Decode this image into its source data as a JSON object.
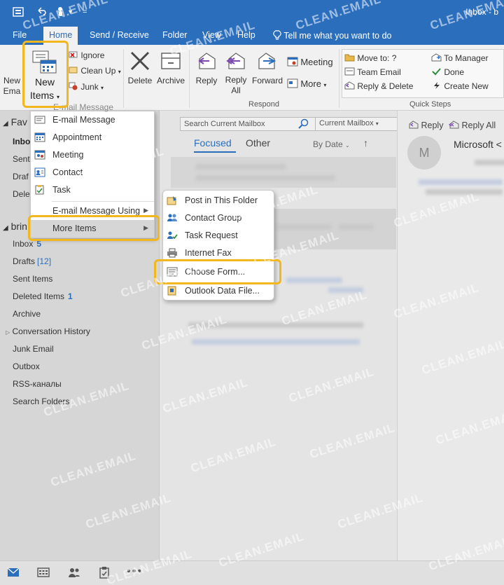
{
  "titlebar": {
    "window_title": "Inbox - b",
    "qa_customize": "="
  },
  "tabs": [
    "File",
    "Home",
    "Send / Receive",
    "Folder",
    "View",
    "Help"
  ],
  "tell_me": "Tell me what you want to do",
  "ribbon": {
    "new_email_line1": "New",
    "new_email_line2": "Ema",
    "new_items_line1": "New",
    "new_items_line2": "Items",
    "ignore": "Ignore",
    "clean_up": "Clean Up",
    "junk": "Junk",
    "delete": "Delete",
    "archive": "Archive",
    "reply": "Reply",
    "reply_all_line1": "Reply",
    "reply_all_line2": "All",
    "forward": "Forward",
    "meeting": "Meeting",
    "more": "More",
    "respond_group": "Respond",
    "qs_move_to": "Move to: ?",
    "qs_team_email": "Team Email",
    "qs_reply_delete": "Reply & Delete",
    "qs_to_manager": "To Manager",
    "qs_done": "Done",
    "qs_create_new": "Create New",
    "quick_steps_group": "Quick Steps"
  },
  "nav": {
    "favorites_label": "Fav",
    "fav_items": [
      "Inbo",
      "Sent",
      "Draf",
      "Dele"
    ],
    "account_label": "brin",
    "folders": [
      {
        "name": "Inbox",
        "count": "5"
      },
      {
        "name": "Drafts",
        "count": "[12]"
      },
      {
        "name": "Sent Items",
        "count": ""
      },
      {
        "name": "Deleted Items",
        "count": "1"
      },
      {
        "name": "Archive",
        "count": ""
      },
      {
        "name": "Conversation History",
        "count": ""
      },
      {
        "name": "Junk Email",
        "count": ""
      },
      {
        "name": "Outbox",
        "count": ""
      },
      {
        "name": "RSS-каналы",
        "count": ""
      },
      {
        "name": "Search Folders",
        "count": ""
      }
    ]
  },
  "middle": {
    "search_placeholder": "Search Current Mailbox",
    "scope": "Current Mailbox",
    "focused_tab": "Focused",
    "other_tab": "Other",
    "sort": "By Date"
  },
  "reading": {
    "reply": "Reply",
    "reply_all": "Reply All",
    "sender": "Microsoft <",
    "avatar_letter": "M"
  },
  "new_items_menu": [
    {
      "label": "E-mail Message",
      "icon": "email-icon",
      "submenu": false
    },
    {
      "label": "Appointment",
      "icon": "calendar-icon",
      "submenu": false
    },
    {
      "label": "Meeting",
      "icon": "meeting-icon",
      "submenu": false
    },
    {
      "label": "Contact",
      "icon": "contact-icon",
      "submenu": false
    },
    {
      "label": "Task",
      "icon": "task-icon",
      "submenu": false
    },
    {
      "label": "E-mail Message Using",
      "icon": "",
      "submenu": true
    },
    {
      "label": "More Items",
      "icon": "",
      "submenu": true
    }
  ],
  "more_items_menu": [
    {
      "label": "Post in This Folder",
      "icon": "post-icon"
    },
    {
      "label": "Contact Group",
      "icon": "contact-group-icon"
    },
    {
      "label": "Task Request",
      "icon": "task-request-icon"
    },
    {
      "label": "Internet Fax",
      "icon": "fax-icon"
    },
    {
      "label": "Choose Form...",
      "icon": "form-icon"
    },
    {
      "label": "Outlook Data File...",
      "icon": "data-file-icon"
    }
  ],
  "ghost_menu_header": "E-mail Message",
  "watermark": "CLEAN.EMAIL",
  "colors": {
    "accent": "#2a6ebc",
    "highlight": "#f2b61f"
  }
}
